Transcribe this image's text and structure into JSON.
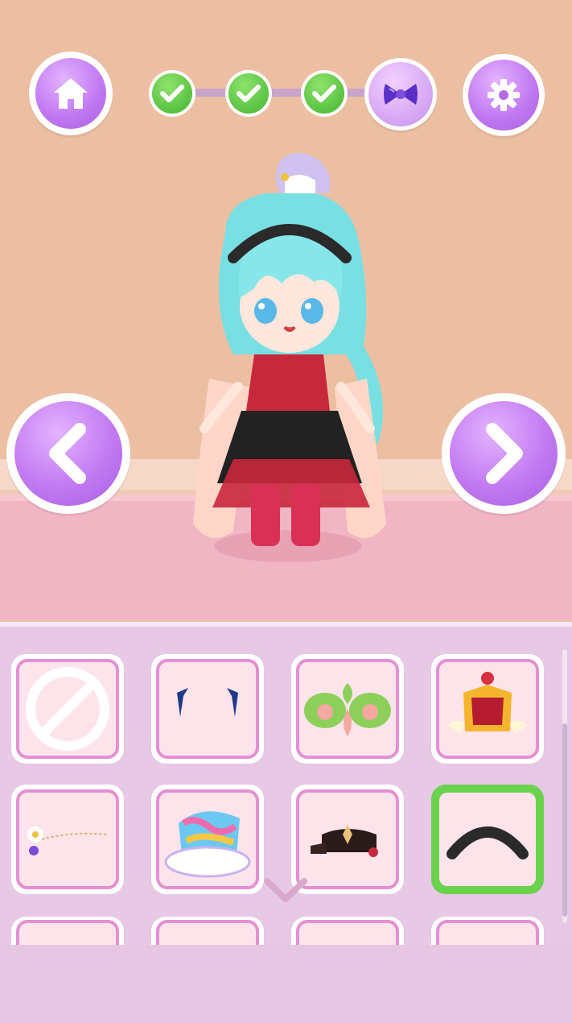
{
  "theme": {
    "accent": "#c27af2",
    "success": "#42b52f",
    "selected_border": "#6bd24e",
    "card_border": "#e58fd2"
  },
  "header": {
    "home_icon": "home-icon",
    "settings_icon": "gear-icon",
    "steps": [
      {
        "name": "step-1",
        "state": "complete",
        "icon": "check-icon"
      },
      {
        "name": "step-2",
        "state": "complete",
        "icon": "check-icon"
      },
      {
        "name": "step-3",
        "state": "complete",
        "icon": "check-icon"
      },
      {
        "name": "step-4",
        "state": "current",
        "icon": "bow-icon"
      }
    ]
  },
  "navigation": {
    "prev_icon": "chevron-left-icon",
    "next_icon": "chevron-right-icon"
  },
  "items": [
    {
      "icon": "none-icon",
      "selected": false
    },
    {
      "icon": "blue-hair-clips-icon",
      "selected": false
    },
    {
      "icon": "green-leaf-headpiece-icon",
      "selected": false
    },
    {
      "icon": "crown-icon",
      "selected": false
    },
    {
      "icon": "flower-chain-icon",
      "selected": false
    },
    {
      "icon": "rainbow-cloud-hat-icon",
      "selected": false
    },
    {
      "icon": "black-cap-icon",
      "selected": false
    },
    {
      "icon": "black-headband-icon",
      "selected": true
    }
  ],
  "more_icon": "chevron-down-icon"
}
